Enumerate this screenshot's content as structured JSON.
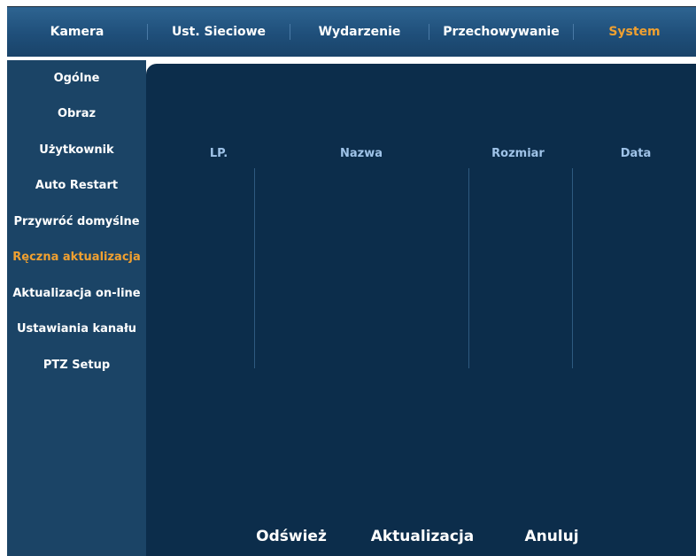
{
  "tabs": [
    {
      "label": "Kamera",
      "active": false
    },
    {
      "label": "Ust. Sieciowe",
      "active": false
    },
    {
      "label": "Wydarzenie",
      "active": false
    },
    {
      "label": "Przechowywanie",
      "active": false
    },
    {
      "label": "System",
      "active": true
    }
  ],
  "sidebar": {
    "items": [
      {
        "label": "Ogólne",
        "active": false
      },
      {
        "label": "Obraz",
        "active": false
      },
      {
        "label": "Użytkownik",
        "active": false
      },
      {
        "label": "Auto Restart",
        "active": false
      },
      {
        "label": "Przywróć domyślne",
        "active": false
      },
      {
        "label": "Ręczna aktualizacja",
        "active": true
      },
      {
        "label": "Aktualizacja on-line",
        "active": false
      },
      {
        "label": "Ustawiania kanału",
        "active": false
      },
      {
        "label": "PTZ Setup",
        "active": false
      }
    ]
  },
  "file_table": {
    "columns": [
      "LP.",
      "Nazwa",
      "Rozmiar",
      "Data"
    ],
    "rows": []
  },
  "actions": {
    "refresh_label": "Odśwież",
    "update_label": "Aktualizacja",
    "cancel_label": "Anuluj"
  },
  "colors": {
    "active_text": "#f0a030",
    "header_bar": "#1f4f7a",
    "sidebar_bg": "#1b4466",
    "panel_bg": "#0c2d4b",
    "column_header_text": "#9fc3e8"
  }
}
